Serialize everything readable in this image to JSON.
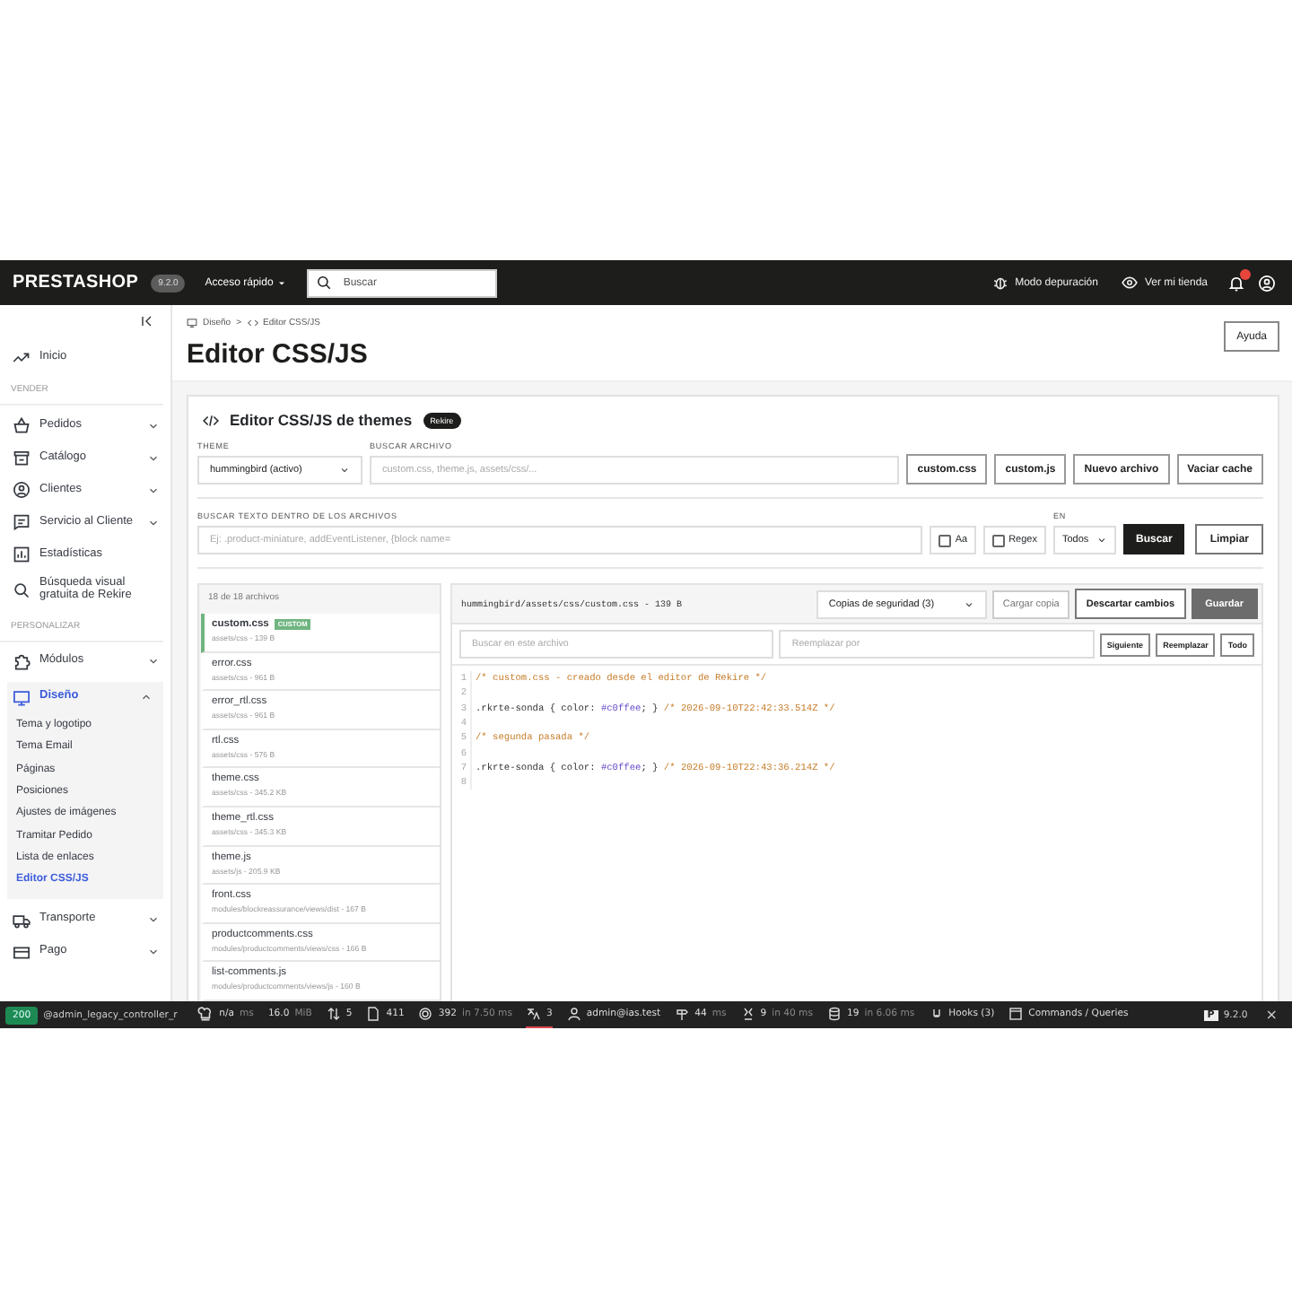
{
  "header": {
    "logo": "PRESTASHOP",
    "version": "9.2.0",
    "quick_access": "Acceso rápido",
    "search": {
      "placeholder": "Buscar"
    },
    "links": [
      "Modo depuración",
      "Ver mi tienda"
    ],
    "notifications": true
  },
  "sidebar": {
    "items": [
      {
        "kind": "item",
        "label": "Inicio",
        "selected": false
      },
      {
        "kind": "section",
        "label": "VENDER"
      },
      {
        "kind": "item",
        "label": "Pedidos",
        "selected": false,
        "expanded": false
      },
      {
        "kind": "item",
        "label": "Catálogo",
        "selected": false,
        "expanded": false
      },
      {
        "kind": "item",
        "label": "Clientes",
        "selected": false,
        "expanded": false
      },
      {
        "kind": "item",
        "label": "Servicio al Cliente",
        "selected": false,
        "expanded": false
      },
      {
        "kind": "item",
        "label": "Estadísticas",
        "selected": false
      },
      {
        "kind": "item",
        "label": "Búsqueda visual gratuita de Rekire",
        "selected": false
      },
      {
        "kind": "section",
        "label": "PERSONALIZAR"
      },
      {
        "kind": "item",
        "label": "Módulos",
        "selected": false,
        "expanded": false
      },
      {
        "kind": "item",
        "label": "Diseño",
        "selected": true,
        "expanded": true,
        "children": [
          {
            "label": "Tema y logotipo",
            "selected": false
          },
          {
            "label": "Tema Email",
            "selected": false
          },
          {
            "label": "Páginas",
            "selected": false
          },
          {
            "label": "Posiciones",
            "selected": false
          },
          {
            "label": "Ajustes de imágenes",
            "selected": false
          },
          {
            "label": "Tramitar Pedido",
            "selected": false
          },
          {
            "label": "Lista de enlaces",
            "selected": false
          },
          {
            "label": "Editor CSS/JS",
            "selected": true
          }
        ]
      },
      {
        "kind": "item",
        "label": "Transporte",
        "selected": false,
        "expanded": false
      },
      {
        "kind": "item",
        "label": "Pago",
        "selected": false,
        "expanded": false
      }
    ]
  },
  "breadcrumb": [
    "Diseño",
    ">",
    "Editor CSS/JS"
  ],
  "page_title": "Editor CSS/JS",
  "help_button": "Ayuda",
  "card": {
    "title": "Editor CSS/JS de themes",
    "badge": "Rekire",
    "theme": {
      "label": "THEME",
      "value": "hummingbird (activo)"
    },
    "file_search": {
      "label": "BUSCAR ARCHIVO",
      "placeholder": "custom.css, theme.js, assets/css/..."
    },
    "quick_buttons": [
      "custom.css",
      "custom.js",
      "Nuevo archivo",
      "Vaciar cache"
    ],
    "text_search": {
      "label": "BUSCAR TEXTO DENTRO DE LOS ARCHIVOS",
      "placeholder": "Ej: .product-miniature, addEventListener, {block name="
    },
    "options": [
      {
        "label": "Aa",
        "checked": false
      },
      {
        "label": "Regex",
        "checked": false
      }
    ],
    "scope": {
      "label": "EN",
      "value": "Todos"
    },
    "search_button": "Buscar",
    "clear_button": "Limpiar"
  },
  "files": {
    "count": "18 de 18 archivos",
    "items": [
      {
        "name": "custom.css",
        "badge": "CUSTOM",
        "meta": "assets/css - 139 B",
        "selected": true
      },
      {
        "name": "error.css",
        "meta": "assets/css - 961 B",
        "selected": false
      },
      {
        "name": "error_rtl.css",
        "meta": "assets/css - 961 B",
        "selected": false
      },
      {
        "name": "rtl.css",
        "meta": "assets/css - 576 B",
        "selected": false
      },
      {
        "name": "theme.css",
        "meta": "assets/css - 345.2 KB",
        "selected": false
      },
      {
        "name": "theme_rtl.css",
        "meta": "assets/css - 345.3 KB",
        "selected": false
      },
      {
        "name": "theme.js",
        "meta": "assets/js - 205.9 KB",
        "selected": false
      },
      {
        "name": "front.css",
        "meta": "modules/blockreassurance/views/dist - 167 B",
        "selected": false
      },
      {
        "name": "productcomments.css",
        "meta": "modules/productcomments/views/css - 166 B",
        "selected": false
      },
      {
        "name": "list-comments.js",
        "meta": "modules/productcomments/views/js - 160 B",
        "selected": false
      }
    ]
  },
  "editor": {
    "path": "hummingbird/assets/css/custom.css - 139 B",
    "backups": "Copias de seguridad (3)",
    "buttons": [
      {
        "label": "Cargar copia",
        "kind": "muted"
      },
      {
        "label": "Descartar cambios",
        "kind": "outline"
      },
      {
        "label": "Guardar",
        "kind": "filled"
      }
    ],
    "find": {
      "placeholder": "Buscar en este archivo"
    },
    "replace": {
      "placeholder": "Reemplazar por"
    },
    "find_buttons": [
      "Siguiente",
      "Reemplazar",
      "Todo"
    ],
    "lines": [
      {
        "number": "1",
        "tokens": [
          {
            "kind": "comment",
            "text": "/* custom.css - creado desde el editor de Rekire */"
          }
        ]
      },
      {
        "number": "2"
      },
      {
        "number": "3",
        "tokens": [
          {
            "kind": "plain",
            "text": ".rkrte-sonda { color: "
          },
          {
            "kind": "value",
            "text": "#c0ffee"
          },
          {
            "kind": "plain",
            "text": "; } "
          },
          {
            "kind": "comment",
            "text": "/* 2026-09-10T22:42:33.514Z */"
          }
        ]
      },
      {
        "number": "4"
      },
      {
        "number": "5",
        "tokens": [
          {
            "kind": "comment",
            "text": "/* segunda pasada */"
          }
        ]
      },
      {
        "number": "6"
      },
      {
        "number": "7",
        "tokens": [
          {
            "kind": "plain",
            "text": ".rkrte-sonda { color: "
          },
          {
            "kind": "value",
            "text": "#c0ffee"
          },
          {
            "kind": "plain",
            "text": "; } "
          },
          {
            "kind": "comment",
            "text": "/* 2026-09-10T22:43:36.214Z */"
          }
        ]
      },
      {
        "number": "8"
      }
    ]
  },
  "debug_bar": {
    "status": "200",
    "route": "@admin_legacy_controller_r",
    "metrics": [
      {
        "value": "n/a",
        "unit": "ms",
        "selected": false
      },
      {
        "value": "16.0",
        "unit": "MiB",
        "selected": false
      },
      {
        "value": "5",
        "selected": false
      },
      {
        "value": "411",
        "selected": false
      },
      {
        "value": "392",
        "unit": "in 7.50 ms",
        "selected": false
      },
      {
        "value": "3",
        "selected": true
      },
      {
        "value": "admin@ias.test",
        "selected": false
      },
      {
        "value": "44",
        "unit": "ms",
        "selected": false
      },
      {
        "value": "9",
        "unit": "in 40 ms",
        "selected": false
      },
      {
        "value": "19",
        "unit": "in 6.06 ms",
        "selected": false
      },
      {
        "value": "Hooks (3)",
        "selected": false
      },
      {
        "value": "Commands / Queries",
        "selected": false
      }
    ],
    "version_logo": "P",
    "version": "9.2.0",
    "close": "×"
  }
}
